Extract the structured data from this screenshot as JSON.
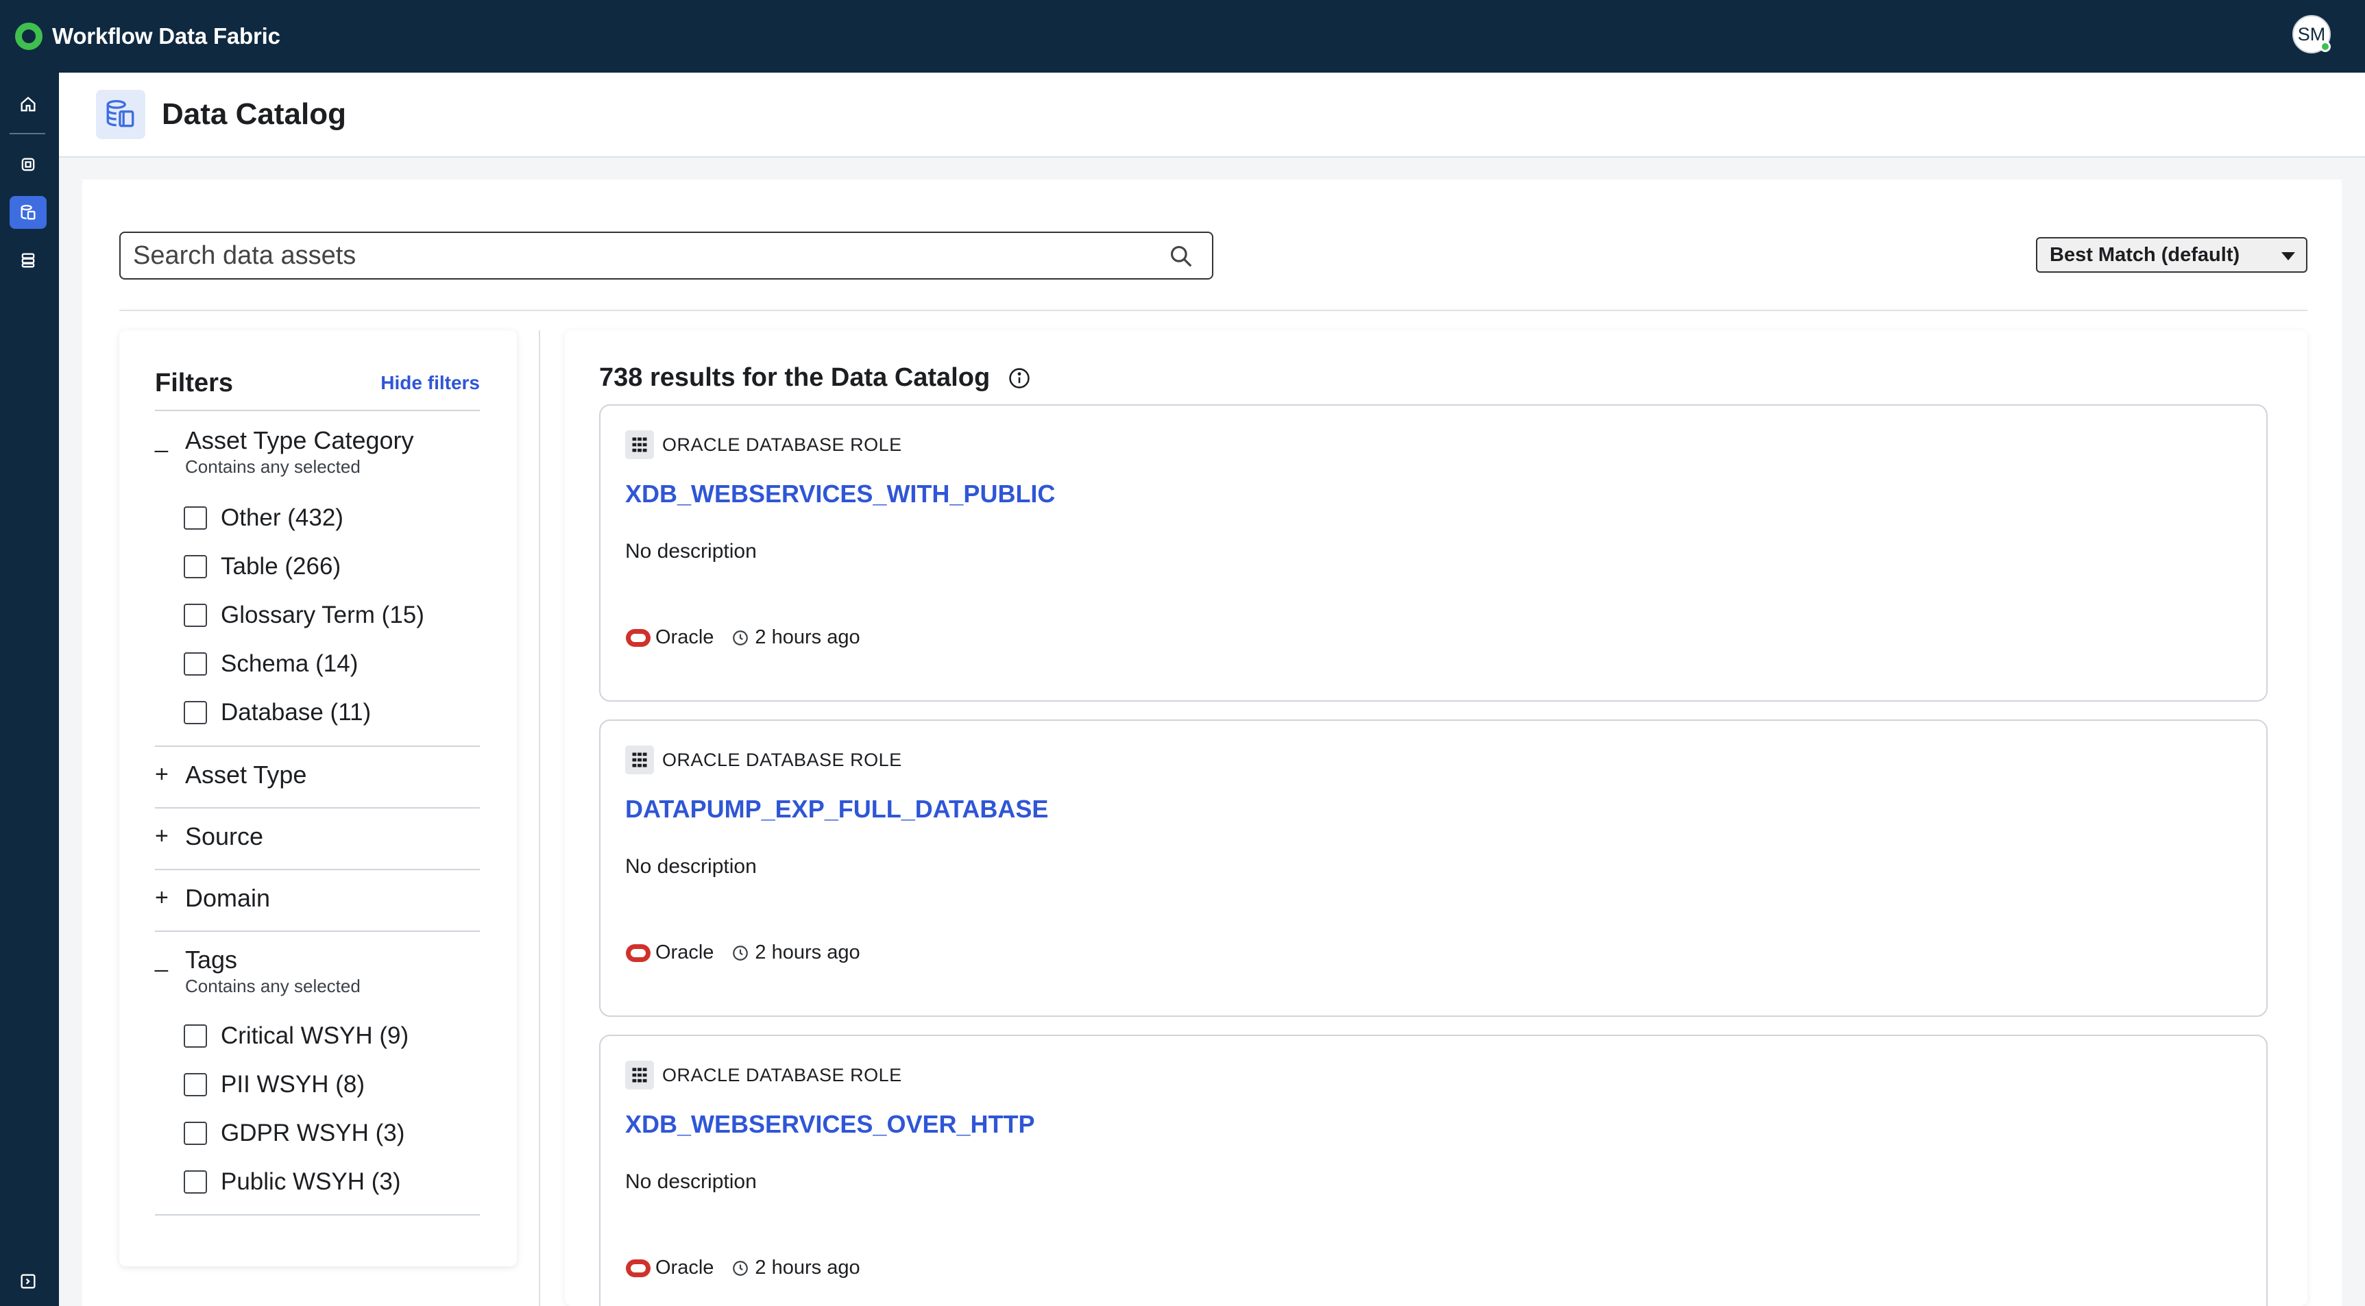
{
  "app": {
    "title": "Workflow Data Fabric",
    "user_initials": "SM",
    "colors": {
      "topbar": "#0f2940",
      "accent": "#2f56d6",
      "logo": "#3fbf4f",
      "oracle": "#d0322b"
    }
  },
  "rail": {
    "items": [
      {
        "name": "home-icon",
        "active": false
      },
      {
        "name": "chip-icon",
        "active": false
      },
      {
        "name": "data-catalog-icon",
        "active": true
      },
      {
        "name": "database-icon",
        "active": false
      }
    ],
    "bottom_item": "collapse-icon"
  },
  "page": {
    "title": "Data Catalog",
    "icon": "data-catalog-icon"
  },
  "search": {
    "placeholder": "Search data assets",
    "value": ""
  },
  "sort": {
    "selected": "Best Match (default)"
  },
  "filters": {
    "title": "Filters",
    "hide_label": "Hide filters",
    "groups": [
      {
        "title": "Asset Type Category",
        "subtitle": "Contains any selected",
        "expanded": true,
        "toggle": "_",
        "options": [
          "Other (432)",
          "Table (266)",
          "Glossary Term (15)",
          "Schema (14)",
          "Database (11)"
        ]
      },
      {
        "title": "Asset Type",
        "expanded": false,
        "toggle": "+"
      },
      {
        "title": "Source",
        "expanded": false,
        "toggle": "+"
      },
      {
        "title": "Domain",
        "expanded": false,
        "toggle": "+"
      },
      {
        "title": "Tags",
        "subtitle": "Contains any selected",
        "expanded": true,
        "toggle": "_",
        "options": [
          "Critical WSYH (9)",
          "PII WSYH (8)",
          "GDPR WSYH (3)",
          "Public WSYH (3)"
        ]
      }
    ]
  },
  "results": {
    "summary": "738 results for the Data Catalog",
    "cards": [
      {
        "type": "ORACLE DATABASE ROLE",
        "name": "XDB_WEBSERVICES_WITH_PUBLIC",
        "description": "No description",
        "source": "Oracle",
        "updated": "2 hours ago"
      },
      {
        "type": "ORACLE DATABASE ROLE",
        "name": "DATAPUMP_EXP_FULL_DATABASE",
        "description": "No description",
        "source": "Oracle",
        "updated": "2 hours ago"
      },
      {
        "type": "ORACLE DATABASE ROLE",
        "name": "XDB_WEBSERVICES_OVER_HTTP",
        "description": "No description",
        "source": "Oracle",
        "updated": "2 hours ago"
      }
    ]
  }
}
